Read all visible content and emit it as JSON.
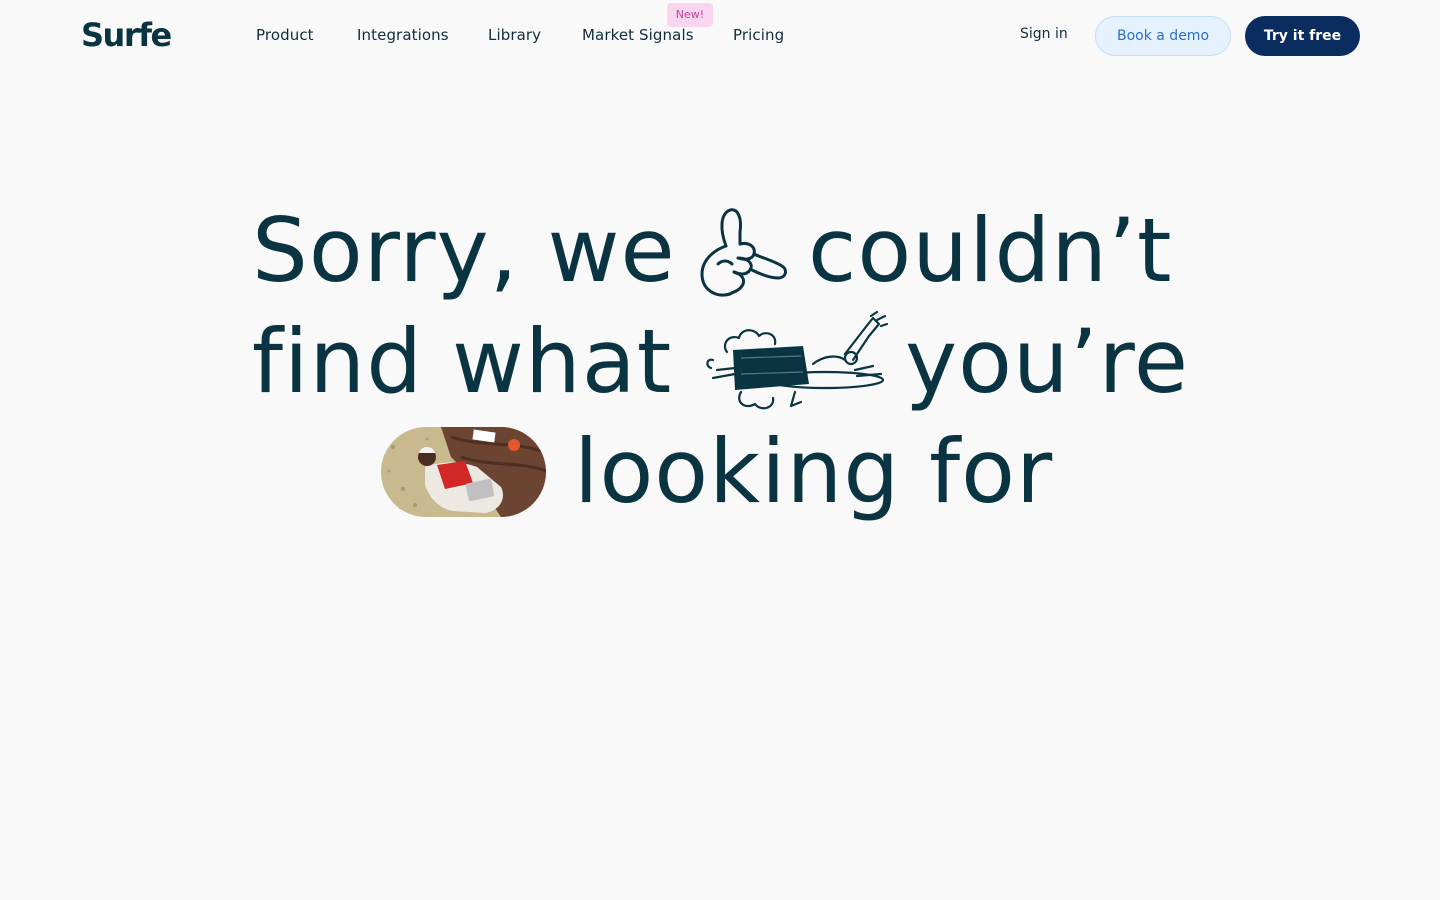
{
  "header": {
    "logo": "Surfe",
    "nav": [
      {
        "label": "Product"
      },
      {
        "label": "Integrations"
      },
      {
        "label": "Library"
      },
      {
        "label": "Market Signals",
        "badge": "New!"
      },
      {
        "label": "Pricing"
      }
    ],
    "sign_in": "Sign in",
    "book_demo": "Book a demo",
    "try_free": "Try it free"
  },
  "hero": {
    "line1": [
      "Sorry, we",
      "couldn’t"
    ],
    "line2": [
      "find what",
      "you’re"
    ],
    "line3": [
      "looking for"
    ]
  },
  "illustrations": [
    {
      "icon": "shaka-hand-icon"
    },
    {
      "icon": "flying-surfer-icon"
    },
    {
      "icon": "person-lying-photo"
    }
  ],
  "colors": {
    "text": "#0a3441",
    "background": "#f9f9fa",
    "primary_button": "#0a2c5e",
    "secondary_button_bg": "#e6f1fe",
    "secondary_button_text": "#2a6fc9",
    "badge_bg": "#f9d5ef",
    "badge_text": "#c2449c"
  }
}
